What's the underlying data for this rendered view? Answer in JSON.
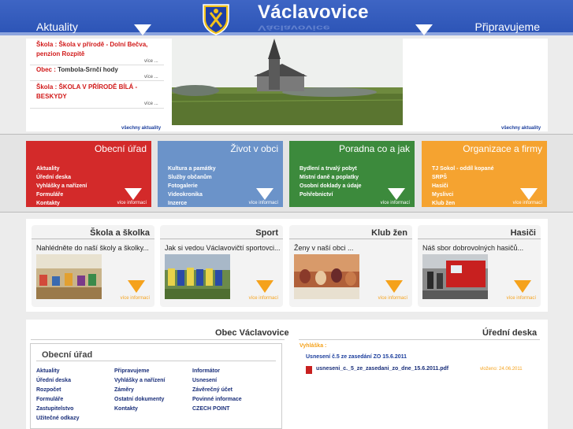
{
  "header": {
    "title": "Václavovice",
    "left_label": "Aktuality",
    "right_label": "Připravujeme"
  },
  "news": {
    "items": [
      {
        "prefix": "Škola : ",
        "text": "Škola v přírodě - Dolní Bečva, penzion Rozpitě"
      },
      {
        "prefix": "Obec : ",
        "text": "Tombola-Srnčí hody"
      },
      {
        "prefix": "Škola : ",
        "text": "ŠKOLA V PŘÍRODĚ BÍLÁ - BESKYDY"
      }
    ],
    "more_label": "více ...",
    "all_label": "všechny aktuality",
    "all_label_right": "všechny aktuality"
  },
  "categories": [
    {
      "title": "Obecní úřad",
      "color": "#d32a2a",
      "links": [
        "Aktuality",
        "Úřední deska",
        "Vyhlášky a nařízení",
        "Formuláře",
        "Kontakty"
      ],
      "more": "více informací"
    },
    {
      "title": "Život v obci",
      "color": "#6b93c9",
      "links": [
        "Kultura a památky",
        "Služby občanům",
        "Fotogalerie",
        "Videokronika",
        "Inzerce"
      ],
      "more": "více informací"
    },
    {
      "title": "Poradna co a jak",
      "color": "#3c8a3c",
      "links": [
        "Bydlení a trvalý pobyt",
        "Místní daně a poplatky",
        "Osobní doklady a údaje",
        "Pohřebnictví"
      ],
      "more": "více informací"
    },
    {
      "title": "Organizace a firmy",
      "color": "#f5a330",
      "links": [
        "TJ Sokol - oddíl kopané",
        "SRPŠ",
        "Hasiči",
        "Myslivci",
        "Klub žen"
      ],
      "more": "více informací"
    }
  ],
  "features": [
    {
      "title": "Škola a školka",
      "text": "Nahlédněte do naší školy a školky...",
      "more": "více informací"
    },
    {
      "title": "Sport",
      "text": "Jak si vedou Václavovičtí sportovci...",
      "more": "více informací"
    },
    {
      "title": "Klub žen",
      "text": "Ženy v naší obci ...",
      "more": "více informací"
    },
    {
      "title": "Hasiči",
      "text": "Náš sbor dobrovolných hasičů...",
      "more": "více informací"
    }
  ],
  "obec": {
    "heading": "Obec Václavovice",
    "box_title": "Obecní úřad",
    "col1": [
      "Aktuality",
      "Úřední deska",
      "Rozpočet",
      "Formuláře",
      "Zastupitelstvo",
      "Užitečné odkazy"
    ],
    "col2": [
      "Připravujeme",
      "Vyhlášky a nařízení",
      "Záměry",
      "Ostatní dokumenty",
      "Kontakty"
    ],
    "col3": [
      "Informátor",
      "Usnesení",
      "Závěrečný účet",
      "Povinné informace",
      "CZECH POINT"
    ]
  },
  "deska": {
    "heading": "Úřední deska",
    "category": "Vyhláška :",
    "item": "Usnesení č.5 ze zasedání ZO 15.6.2011",
    "file": "usneseni_c._5_ze_zasedani_zo_dne_15.6.2011.pdf",
    "posted": "vloženo: 24.06.2011"
  }
}
